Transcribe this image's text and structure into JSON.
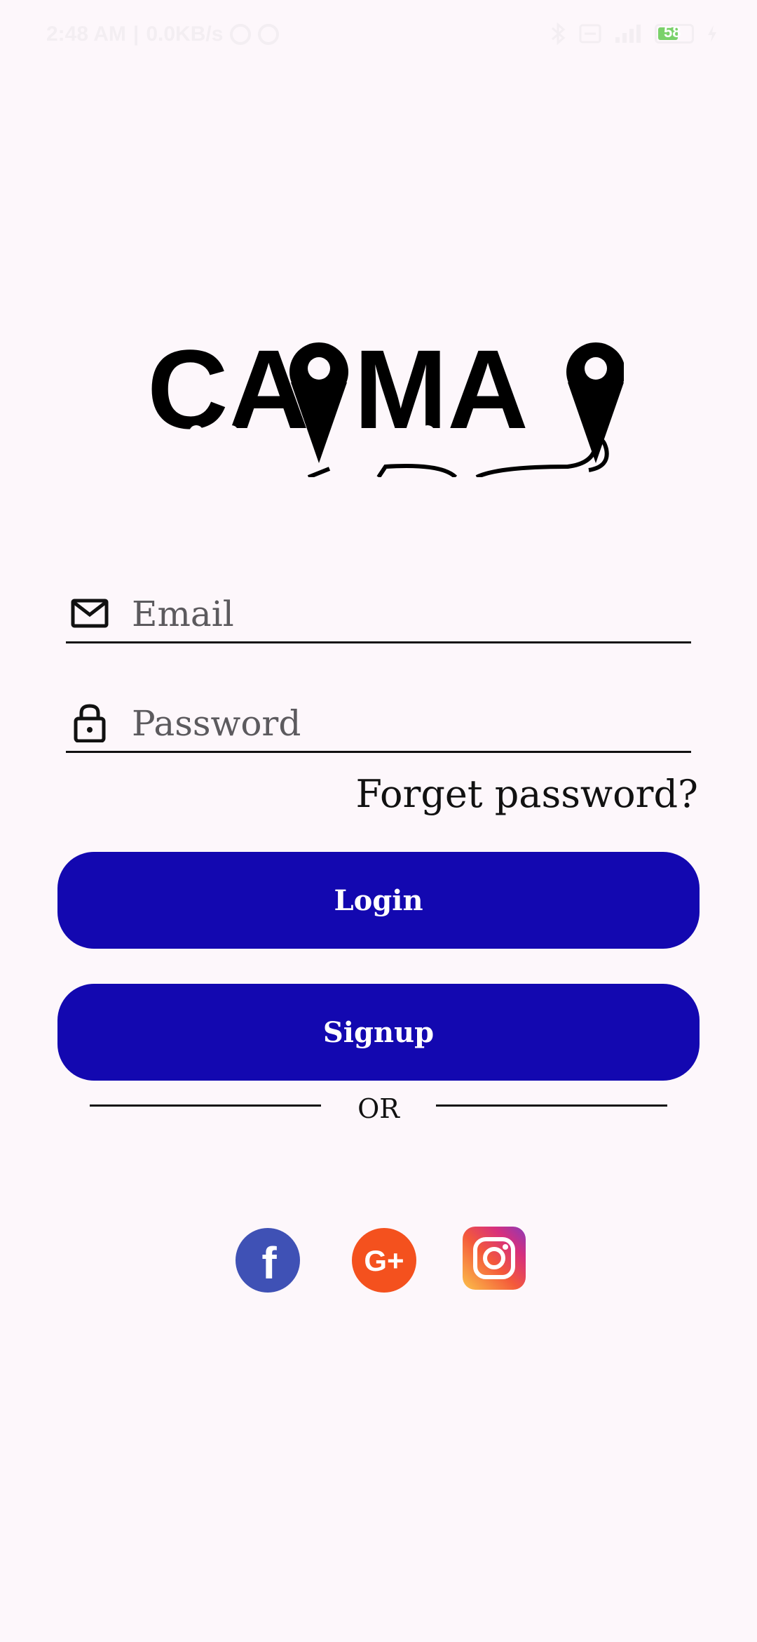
{
  "status_bar": {
    "time": "2:48 AM",
    "speed": "0.0KB/s",
    "battery": "58"
  },
  "logo": {
    "text": "CAPMAP"
  },
  "form": {
    "email_placeholder": "Email",
    "password_placeholder": "Password",
    "forget_password": "Forget password?"
  },
  "buttons": {
    "login": "Login",
    "signup": "Signup"
  },
  "divider": {
    "or": "OR"
  },
  "social": {
    "facebook_letter": "f",
    "google_text": "G+",
    "colors": {
      "facebook": "#3f51b5",
      "google": "#f4511e",
      "instagram": "#e1306c"
    }
  },
  "colors": {
    "primary": "#1308b0",
    "background": "#fdf7fb",
    "battery": "#7ad16a"
  }
}
